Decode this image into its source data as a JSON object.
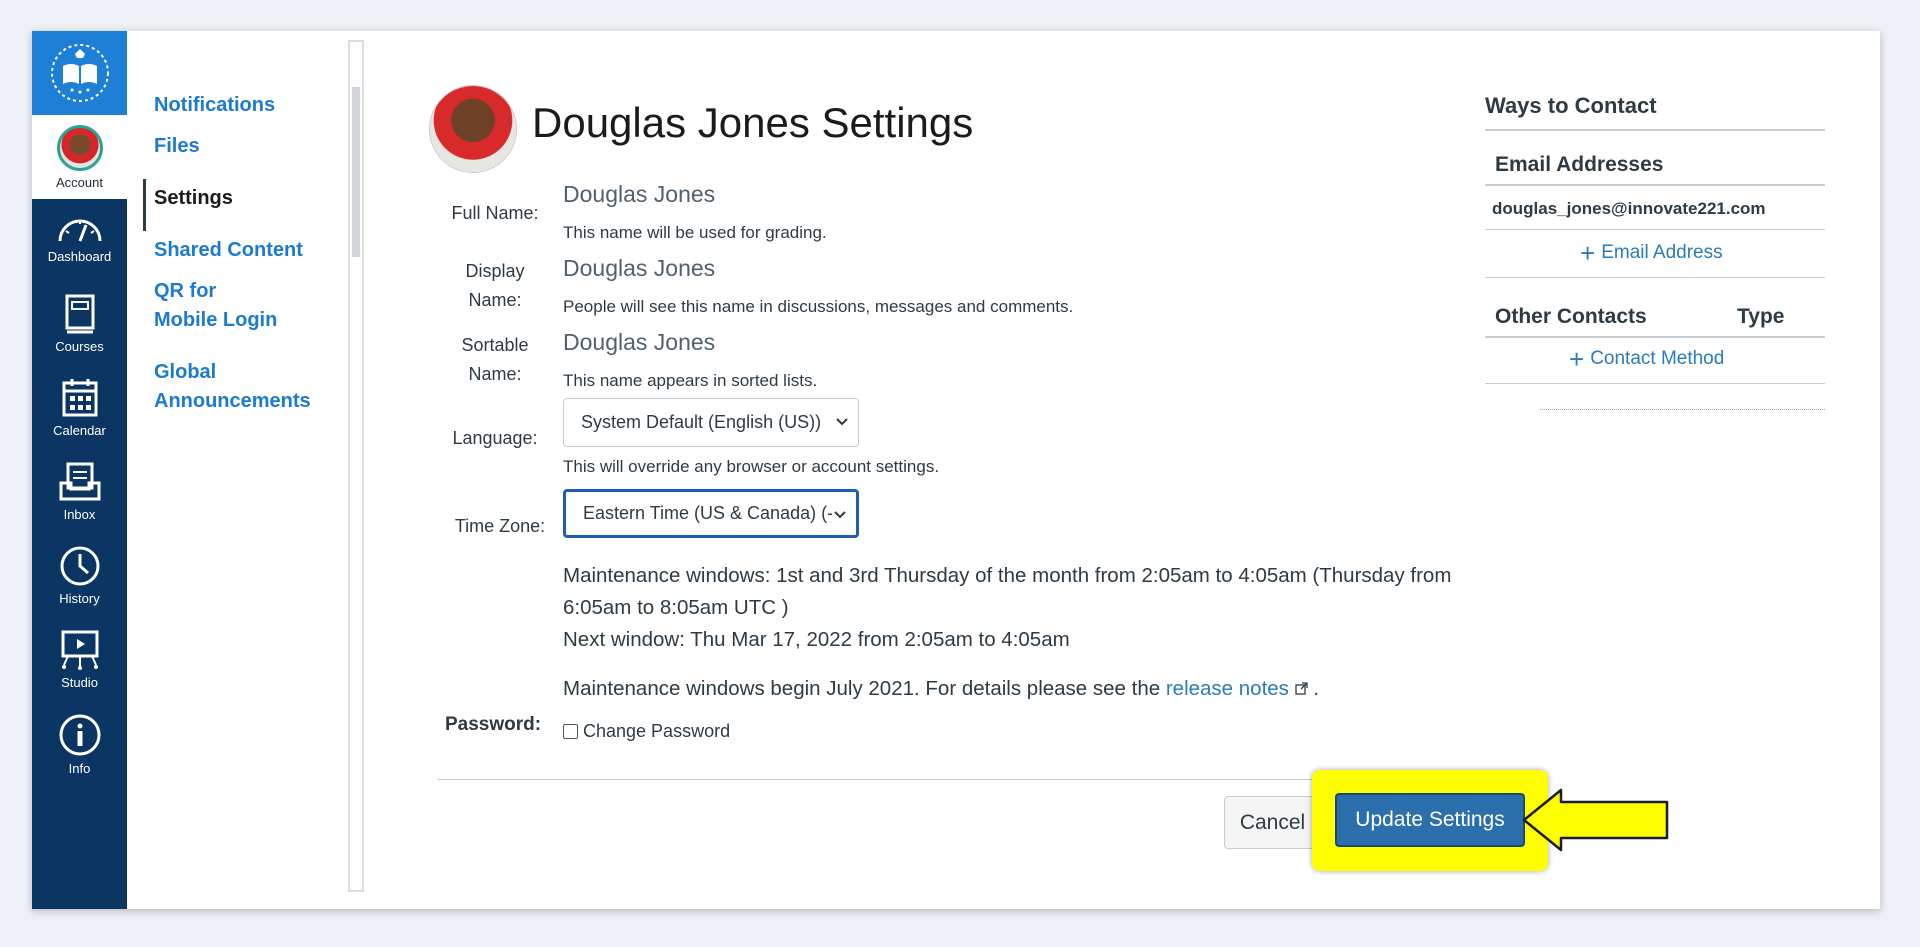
{
  "global_nav": {
    "account_label": "Account",
    "items": [
      {
        "label": "Dashboard",
        "icon": "dashboard-icon"
      },
      {
        "label": "Courses",
        "icon": "courses-icon"
      },
      {
        "label": "Calendar",
        "icon": "calendar-icon"
      },
      {
        "label": "Inbox",
        "icon": "inbox-icon"
      },
      {
        "label": "History",
        "icon": "history-icon"
      },
      {
        "label": "Studio",
        "icon": "studio-icon"
      },
      {
        "label": "Info",
        "icon": "info-icon"
      }
    ],
    "colors": {
      "background": "#0b3563",
      "logo_bg": "#1e7fd6"
    }
  },
  "user_nav": {
    "items": [
      {
        "label": "Notifications"
      },
      {
        "label": "Files"
      },
      {
        "label": "Settings",
        "active": true
      },
      {
        "label": "Shared Content"
      },
      {
        "label": "QR for\nMobile Login"
      },
      {
        "label": "Global\nAnnouncements"
      }
    ]
  },
  "main": {
    "title": "Douglas Jones Settings",
    "full_name": {
      "label": "Full Name:",
      "value": "Douglas Jones",
      "hint": "This name will be used for grading."
    },
    "display_name": {
      "label": "Display\nName:",
      "value": "Douglas Jones",
      "hint": "People will see this name in discussions, messages and comments."
    },
    "sortable_name": {
      "label": "Sortable\nName:",
      "value": "Douglas Jones",
      "hint": "This name appears in sorted lists."
    },
    "language": {
      "label": "Language:",
      "value": "System Default (English (US))",
      "hint": "This will override any browser or account settings."
    },
    "time_zone": {
      "label": "Time Zone:",
      "value": "Eastern Time (US & Canada) (-"
    },
    "maintenance": {
      "line1": "Maintenance windows: 1st and 3rd Thursday of the month from 2:05am to 4:05am (Thursday from 6:05am to 8:05am UTC )",
      "line2": "Next window: Thu Mar 17, 2022 from 2:05am to 4:05am",
      "details_prefix": "Maintenance windows begin July 2021. For details please see the ",
      "details_link": "release notes",
      "details_suffix": " ."
    },
    "password": {
      "label": "Password:",
      "checkbox_label": "Change Password",
      "checked": false
    },
    "buttons": {
      "cancel": "Cancel",
      "update": "Update Settings"
    },
    "colors": {
      "primary": "#2b6fad",
      "highlight": "#ffff00",
      "link": "#2b7abc"
    }
  },
  "sidebar": {
    "title": "Ways to Contact",
    "email_header": "Email Addresses",
    "email": "douglas_jones@innovate221.com",
    "add_email": "Email Address",
    "other_header": "Other Contacts",
    "type_header": "Type",
    "add_contact": "Contact Method"
  }
}
